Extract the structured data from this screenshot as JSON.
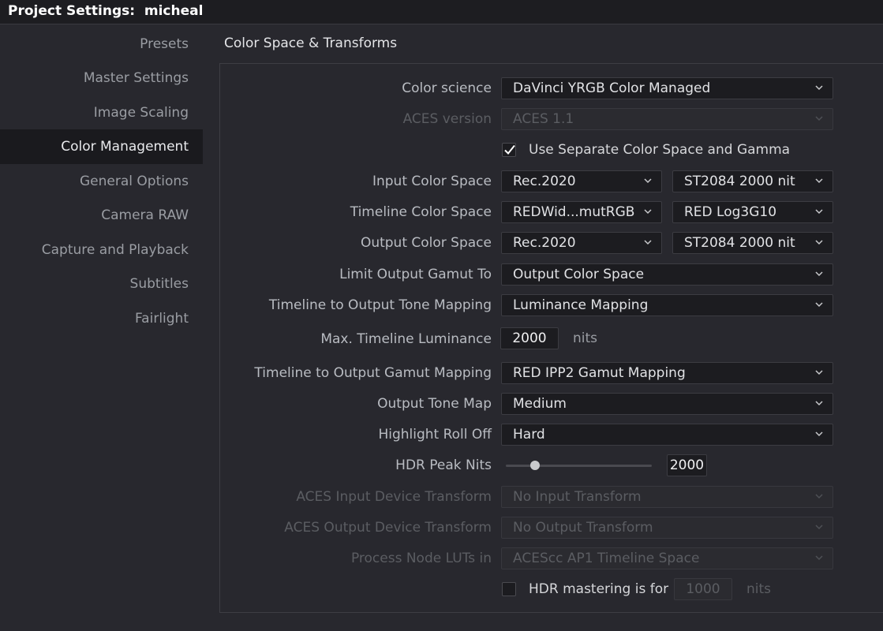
{
  "window": {
    "title": "Project Settings:  micheal"
  },
  "sidebar": {
    "items": [
      {
        "label": "Presets",
        "active": false
      },
      {
        "label": "Master Settings",
        "active": false
      },
      {
        "label": "Image Scaling",
        "active": false
      },
      {
        "label": "Color Management",
        "active": true
      },
      {
        "label": "General Options",
        "active": false
      },
      {
        "label": "Camera RAW",
        "active": false
      },
      {
        "label": "Capture and Playback",
        "active": false
      },
      {
        "label": "Subtitles",
        "active": false
      },
      {
        "label": "Fairlight",
        "active": false
      }
    ]
  },
  "section": {
    "title": "Color Space & Transforms"
  },
  "fields": {
    "color_science": {
      "label": "Color science",
      "value": "DaVinci YRGB Color Managed"
    },
    "aces_version": {
      "label": "ACES version",
      "value": "ACES 1.1"
    },
    "separate_cs_gamma": {
      "label": "Use Separate Color Space and Gamma",
      "checked": true
    },
    "input_color_space": {
      "label": "Input Color Space",
      "space": "Rec.2020",
      "gamma": "ST2084 2000 nit"
    },
    "timeline_color_space": {
      "label": "Timeline Color Space",
      "space": "REDWid...mutRGB",
      "gamma": "RED Log3G10"
    },
    "output_color_space": {
      "label": "Output Color Space",
      "space": "Rec.2020",
      "gamma": "ST2084 2000 nit"
    },
    "limit_output_gamut": {
      "label": "Limit Output Gamut To",
      "value": "Output Color Space"
    },
    "tone_mapping": {
      "label": "Timeline to Output Tone Mapping",
      "value": "Luminance Mapping"
    },
    "max_timeline_luminance": {
      "label": "Max. Timeline Luminance",
      "value": "2000",
      "unit": "nits"
    },
    "gamut_mapping": {
      "label": "Timeline to Output Gamut Mapping",
      "value": "RED IPP2 Gamut Mapping"
    },
    "output_tone_map": {
      "label": "Output Tone Map",
      "value": "Medium"
    },
    "highlight_roll_off": {
      "label": "Highlight Roll Off",
      "value": "Hard"
    },
    "hdr_peak_nits": {
      "label": "HDR Peak Nits",
      "value": "2000",
      "slider_fraction": 0.2
    },
    "aces_input_transform": {
      "label": "ACES Input Device Transform",
      "value": "No Input Transform"
    },
    "aces_output_transform": {
      "label": "ACES Output Device Transform",
      "value": "No Output Transform"
    },
    "process_node_luts": {
      "label": "Process Node LUTs in",
      "value": "ACEScc AP1 Timeline Space"
    },
    "hdr_mastering": {
      "label": "HDR mastering is for",
      "checked": false,
      "value": "1000",
      "unit": "nits"
    }
  },
  "colors": {
    "background": "#28282e",
    "titlebar": "#1d1d21",
    "active_nav": "#1a1a1e",
    "field_bg": "#1c1c20",
    "disabled_text": "#5b5d62"
  }
}
